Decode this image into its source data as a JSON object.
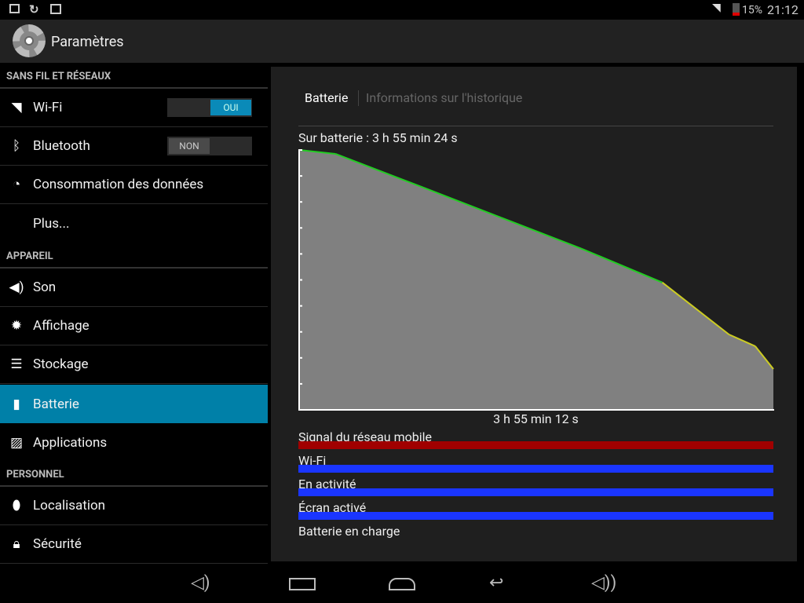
{
  "status_bar": {
    "battery_percent": "15%",
    "time": "21:12",
    "icons": [
      "gallery-icon",
      "sync-icon",
      "clipboard-check-icon",
      "wifi-icon",
      "battery-icon"
    ]
  },
  "action_bar": {
    "title": "Paramètres",
    "icon": "settings-gear-icon"
  },
  "sidebar": {
    "sections": [
      {
        "label": "SANS FIL ET RÉSEAUX"
      },
      {
        "label": "APPAREIL"
      },
      {
        "label": "PERSONNEL"
      }
    ],
    "items": [
      {
        "label": "Wi-Fi",
        "icon": "wifi-icon",
        "toggle": "OUI"
      },
      {
        "label": "Bluetooth",
        "icon": "bluetooth-icon",
        "toggle": "NON"
      },
      {
        "label": "Consommation des données",
        "icon": "data-usage-icon"
      },
      {
        "label": "Plus..."
      },
      {
        "label": "Son",
        "icon": "speaker-icon"
      },
      {
        "label": "Affichage",
        "icon": "brightness-icon"
      },
      {
        "label": "Stockage",
        "icon": "storage-icon"
      },
      {
        "label": "Batterie",
        "icon": "battery-icon",
        "selected": true
      },
      {
        "label": "Applications",
        "icon": "apps-icon"
      },
      {
        "label": "Localisation",
        "icon": "location-pin-icon"
      },
      {
        "label": "Sécurité",
        "icon": "lock-icon"
      }
    ]
  },
  "panel": {
    "tabs": [
      {
        "label": "Batterie",
        "active": true
      },
      {
        "label": "Informations sur l'historique"
      }
    ],
    "on_battery": "Sur batterie : 3 h 55 min 24 s",
    "duration": "3 h 55 min 12 s",
    "legend": [
      {
        "label": "Signal du réseau mobile",
        "color": "#a00000"
      },
      {
        "label": "Wi-Fi",
        "color": "#1a35ff"
      },
      {
        "label": "En activité",
        "color": "#1a35ff"
      },
      {
        "label": "Écran activé",
        "color": "#1a35ff"
      },
      {
        "label": "Batterie en charge",
        "color": null
      }
    ]
  },
  "chart_data": {
    "type": "area",
    "xlabel": "",
    "ylabel": "",
    "x_unit": "minutes",
    "y_unit": "battery %",
    "ylim": [
      0,
      100
    ],
    "xlim": [
      0,
      235
    ],
    "x": [
      0,
      18,
      60,
      100,
      140,
      180,
      213,
      226,
      235
    ],
    "y": [
      100,
      98.5,
      86,
      74,
      62,
      49,
      29,
      24.5,
      15.7
    ],
    "line_colors": {
      "normal": "#22cc22",
      "low": "#cccc22"
    },
    "fill_color": "#808080"
  }
}
